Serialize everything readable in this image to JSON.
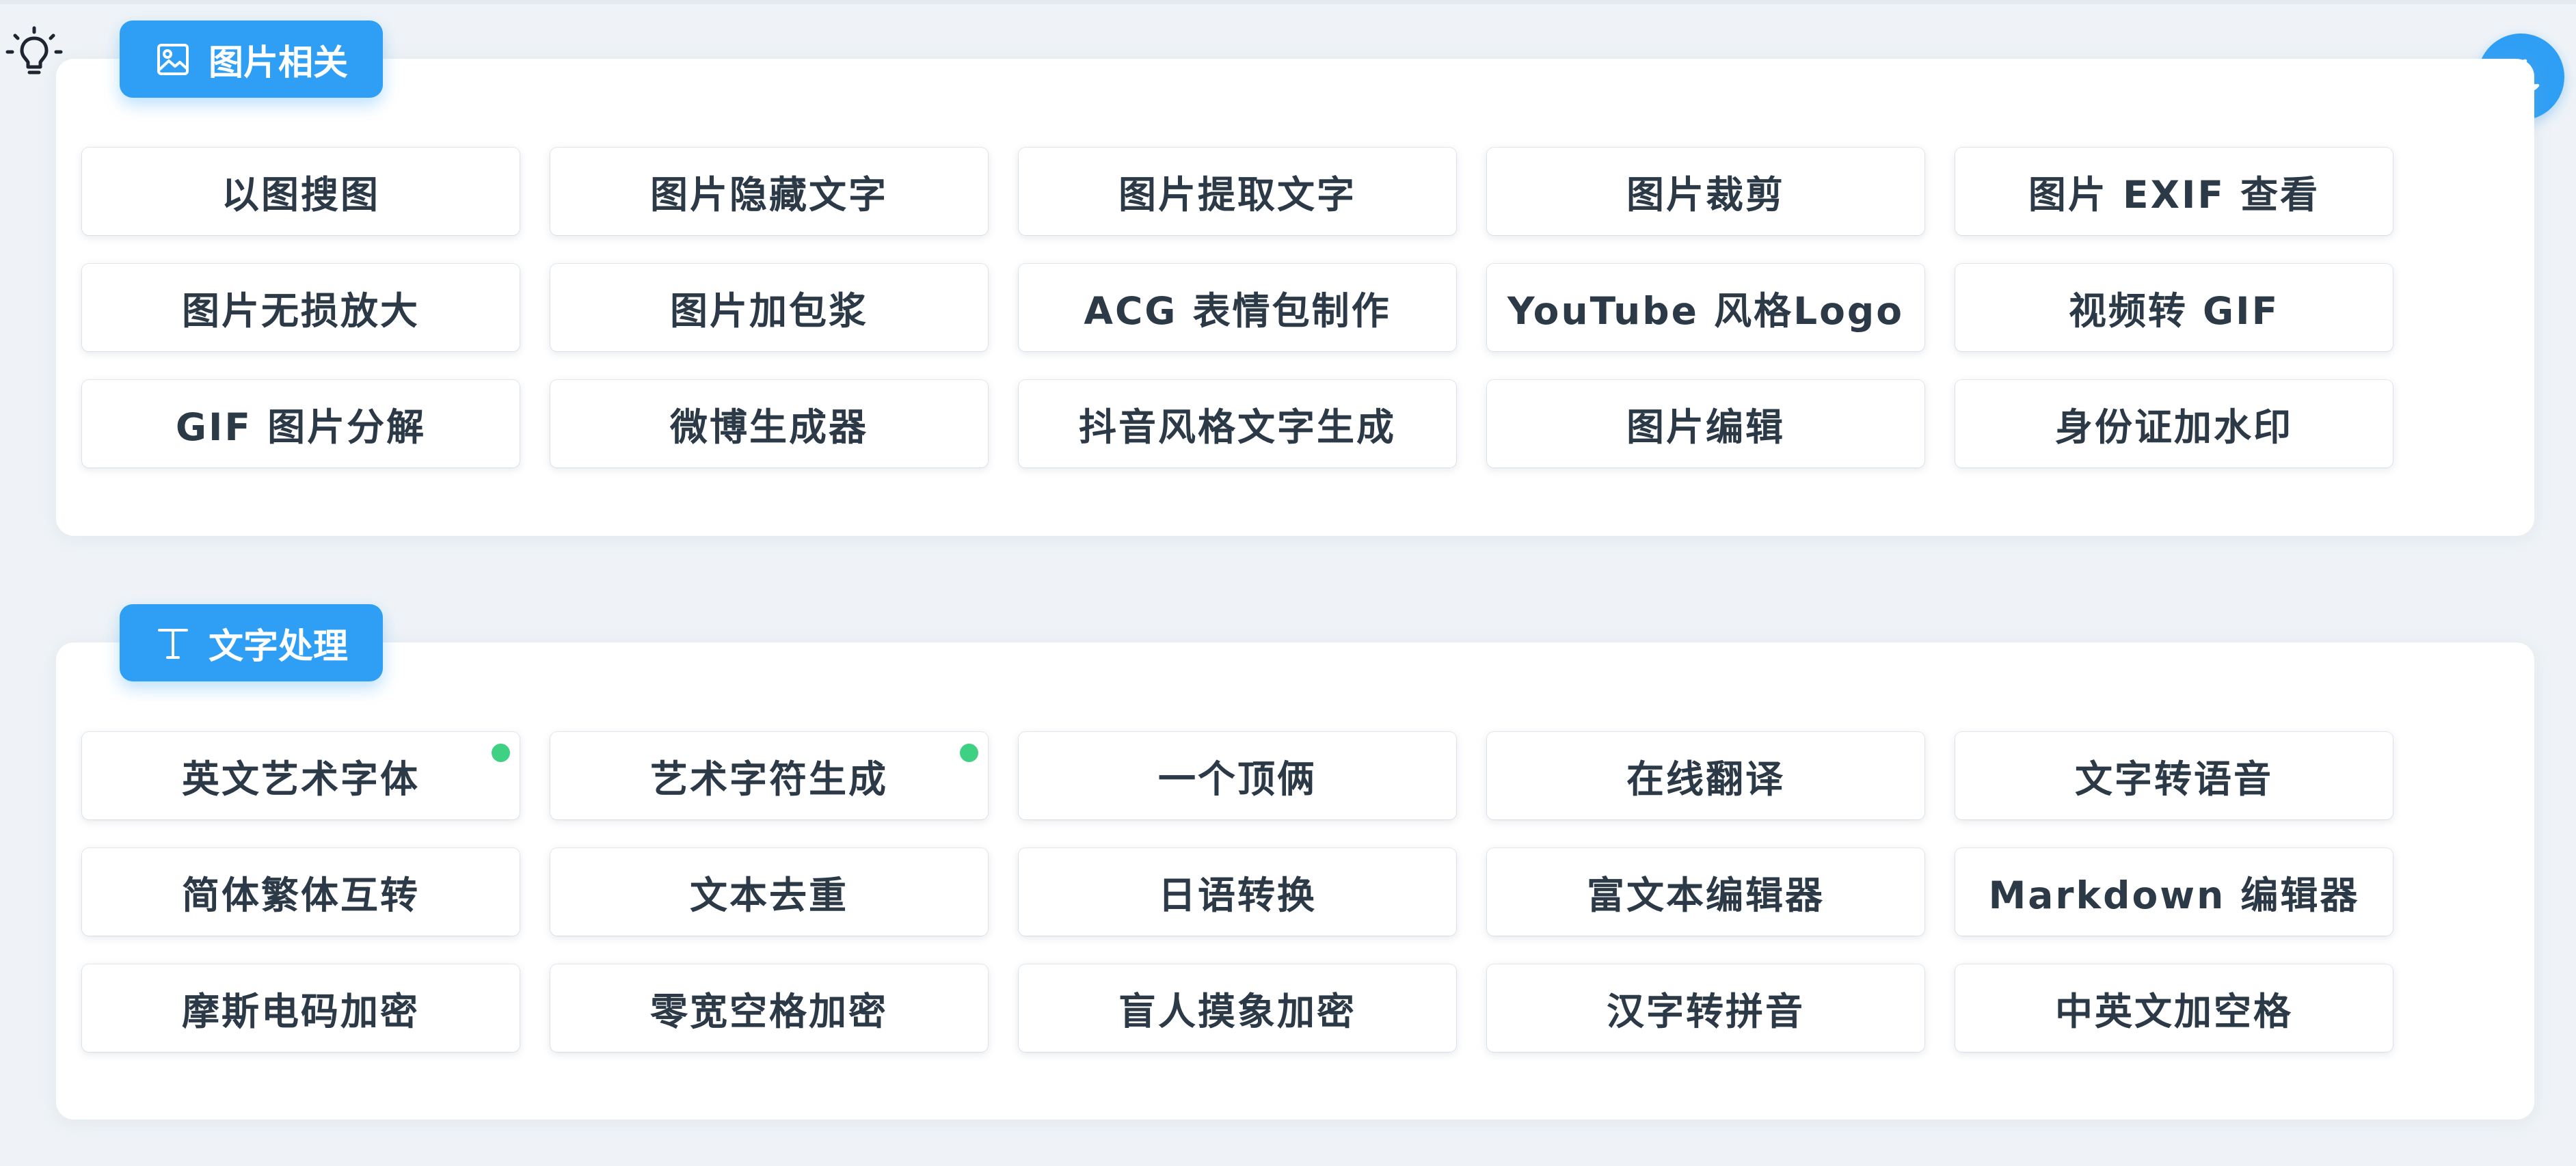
{
  "sections": [
    {
      "title": "图片相关",
      "icon": "image-icon",
      "tools": [
        {
          "label": "以图搜图"
        },
        {
          "label": "图片隐藏文字"
        },
        {
          "label": "图片提取文字"
        },
        {
          "label": "图片裁剪"
        },
        {
          "label": "图片 EXIF 查看"
        },
        {
          "label": "图片无损放大"
        },
        {
          "label": "图片加包浆"
        },
        {
          "label": "ACG 表情包制作"
        },
        {
          "label": "YouTube 风格Logo"
        },
        {
          "label": "视频转 GIF"
        },
        {
          "label": "GIF 图片分解"
        },
        {
          "label": "微博生成器"
        },
        {
          "label": "抖音风格文字生成"
        },
        {
          "label": "图片编辑"
        },
        {
          "label": "身份证加水印"
        }
      ]
    },
    {
      "title": "文字处理",
      "icon": "text-icon",
      "tools": [
        {
          "label": "英文艺术字体",
          "new_dot": true
        },
        {
          "label": "艺术字符生成",
          "new_dot": true
        },
        {
          "label": "一个顶俩"
        },
        {
          "label": "在线翻译"
        },
        {
          "label": "文字转语音"
        },
        {
          "label": "简体繁体互转"
        },
        {
          "label": "文本去重"
        },
        {
          "label": "日语转换"
        },
        {
          "label": "富文本编辑器"
        },
        {
          "label": "Markdown 编辑器"
        },
        {
          "label": "摩斯电码加密"
        },
        {
          "label": "零宽空格加密"
        },
        {
          "label": "盲人摸象加密"
        },
        {
          "label": "汉字转拼音"
        },
        {
          "label": "中英文加空格"
        }
      ]
    }
  ],
  "icons": {
    "top_left": "lightbulb-icon",
    "top_right": "moon-icon"
  },
  "colors": {
    "accent": "#2f9ff5",
    "new_dot": "#3fd183",
    "background": "#eff3f7",
    "text": "#2c3a48"
  }
}
